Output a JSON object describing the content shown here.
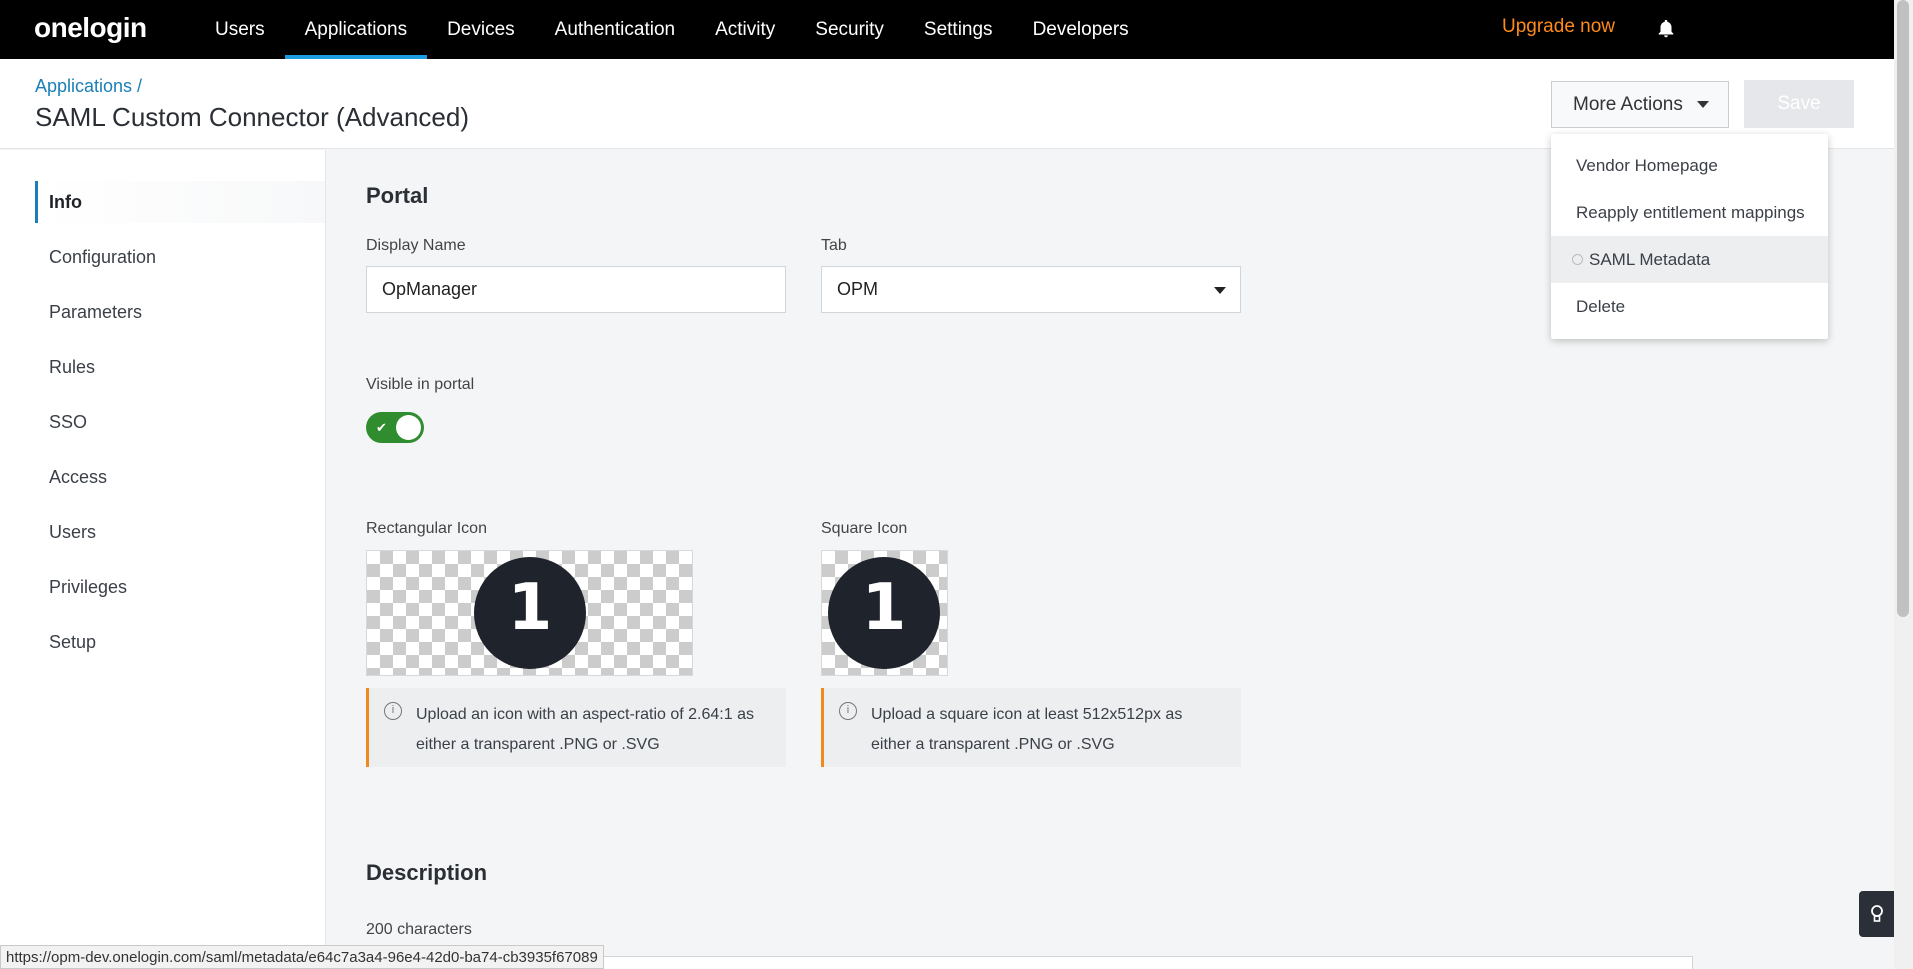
{
  "nav": {
    "logo": "onelogin",
    "items": [
      {
        "label": "Users"
      },
      {
        "label": "Applications"
      },
      {
        "label": "Devices"
      },
      {
        "label": "Authentication"
      },
      {
        "label": "Activity"
      },
      {
        "label": "Security"
      },
      {
        "label": "Settings"
      },
      {
        "label": "Developers"
      }
    ],
    "active_item": "Applications",
    "upgrade_label": "Upgrade now",
    "bell_icon": "bell-icon"
  },
  "header": {
    "breadcrumb": "Applications /",
    "title": "SAML Custom Connector (Advanced)",
    "more_actions_label": "More Actions",
    "save_label": "Save"
  },
  "sidebar": {
    "items": [
      {
        "label": "Info"
      },
      {
        "label": "Configuration"
      },
      {
        "label": "Parameters"
      },
      {
        "label": "Rules"
      },
      {
        "label": "SSO"
      },
      {
        "label": "Access"
      },
      {
        "label": "Users"
      },
      {
        "label": "Privileges"
      },
      {
        "label": "Setup"
      }
    ],
    "active_item": "Info"
  },
  "portal": {
    "heading": "Portal",
    "display_name_label": "Display Name",
    "display_name_value": "OpManager",
    "tab_label": "Tab",
    "tab_value": "OPM",
    "visible_label": "Visible in portal",
    "visible_on": true,
    "rect_icon_label": "Rectangular Icon",
    "square_icon_label": "Square Icon",
    "icon_glyph": "1",
    "rect_note": "Upload an icon with an aspect-ratio of 2.64:1 as either a transparent .PNG or .SVG",
    "square_note": "Upload a square icon at least 512x512px as either a transparent .PNG or .SVG"
  },
  "description": {
    "heading": "Description",
    "char_count": "200 characters"
  },
  "menu": {
    "items": [
      {
        "label": "Vendor Homepage"
      },
      {
        "label": "Reapply entitlement mappings"
      },
      {
        "label": "SAML Metadata"
      },
      {
        "label": "Delete"
      }
    ],
    "hovered_item": "SAML Metadata"
  },
  "status_url": "https://opm-dev.onelogin.com/saml/metadata/e64c7a3a4-96e4-42d0-ba74-cb3935f67089",
  "colors": {
    "nav_bg": "#000000",
    "accent": "#1e9ce0",
    "upgrade": "#ff8a1c",
    "toggle_on": "#2f8d2f",
    "note_border": "#ef8a1f"
  }
}
